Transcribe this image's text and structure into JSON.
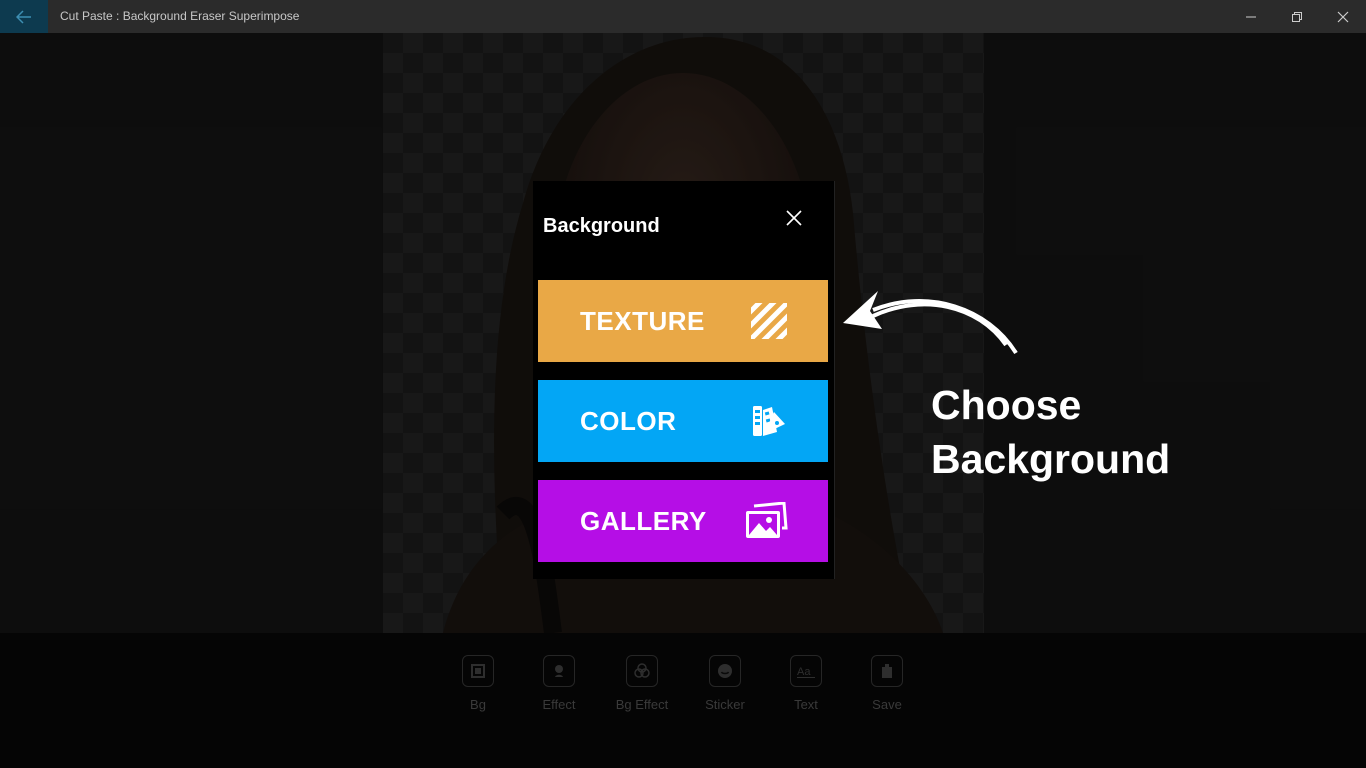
{
  "window": {
    "title": "Cut Paste : Background Eraser Superimpose",
    "icons": {
      "back": "back-arrow-icon",
      "minimize": "minimize-icon",
      "restore": "restore-icon",
      "close": "close-icon"
    }
  },
  "dialog": {
    "title": "Background",
    "options": [
      {
        "label": "TEXTURE",
        "icon": "texture-stripes-icon",
        "color": "#e9a846"
      },
      {
        "label": "COLOR",
        "icon": "color-palette-icon",
        "color": "#03a6f5"
      },
      {
        "label": "GALLERY",
        "icon": "gallery-images-icon",
        "color": "#b50ee6"
      }
    ]
  },
  "annotation": {
    "line1": "Choose",
    "line2": "Background"
  },
  "toolbar": {
    "items": [
      {
        "label": "Bg",
        "icon": "bg-icon"
      },
      {
        "label": "Effect",
        "icon": "effect-icon"
      },
      {
        "label": "Bg Effect",
        "icon": "bg-effect-icon"
      },
      {
        "label": "Sticker",
        "icon": "sticker-icon"
      },
      {
        "label": "Text",
        "icon": "text-icon"
      },
      {
        "label": "Save",
        "icon": "save-icon"
      }
    ]
  }
}
